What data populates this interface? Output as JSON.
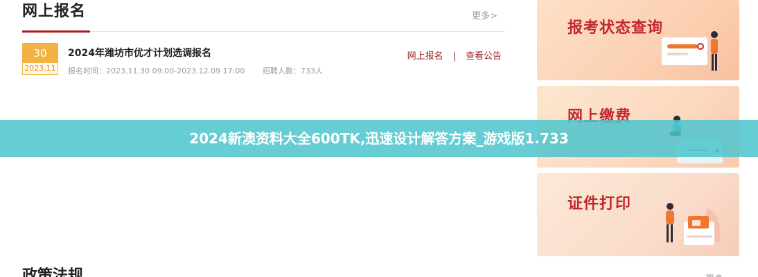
{
  "registration": {
    "title": "网上报名",
    "more": "更多>",
    "item": {
      "day": "30",
      "year_month": "2023.11",
      "name": "2024年潍坊市优才计划选调报名",
      "time": "报名时间：2023.11.30 09:00-2023.12.09 17:00",
      "count": "招聘人数：733人",
      "action_register": "网上报名",
      "separator": "|",
      "action_notice": "查看公告"
    }
  },
  "policy": {
    "title": "政策法规",
    "more": "更多"
  },
  "cards": [
    {
      "label": "报考状态查询",
      "icon": "search-status-illustration"
    },
    {
      "label": "网上缴费",
      "icon": "online-payment-illustration"
    },
    {
      "label": "证件打印",
      "icon": "document-print-illustration"
    }
  ],
  "banner": {
    "text": "2024新澳资料大全600TK,迅速设计解答方案_游戏版1.733"
  },
  "colors": {
    "accent_red": "#b3161b",
    "badge_orange": "#f3b244",
    "banner_teal": "#4cc4cd"
  }
}
